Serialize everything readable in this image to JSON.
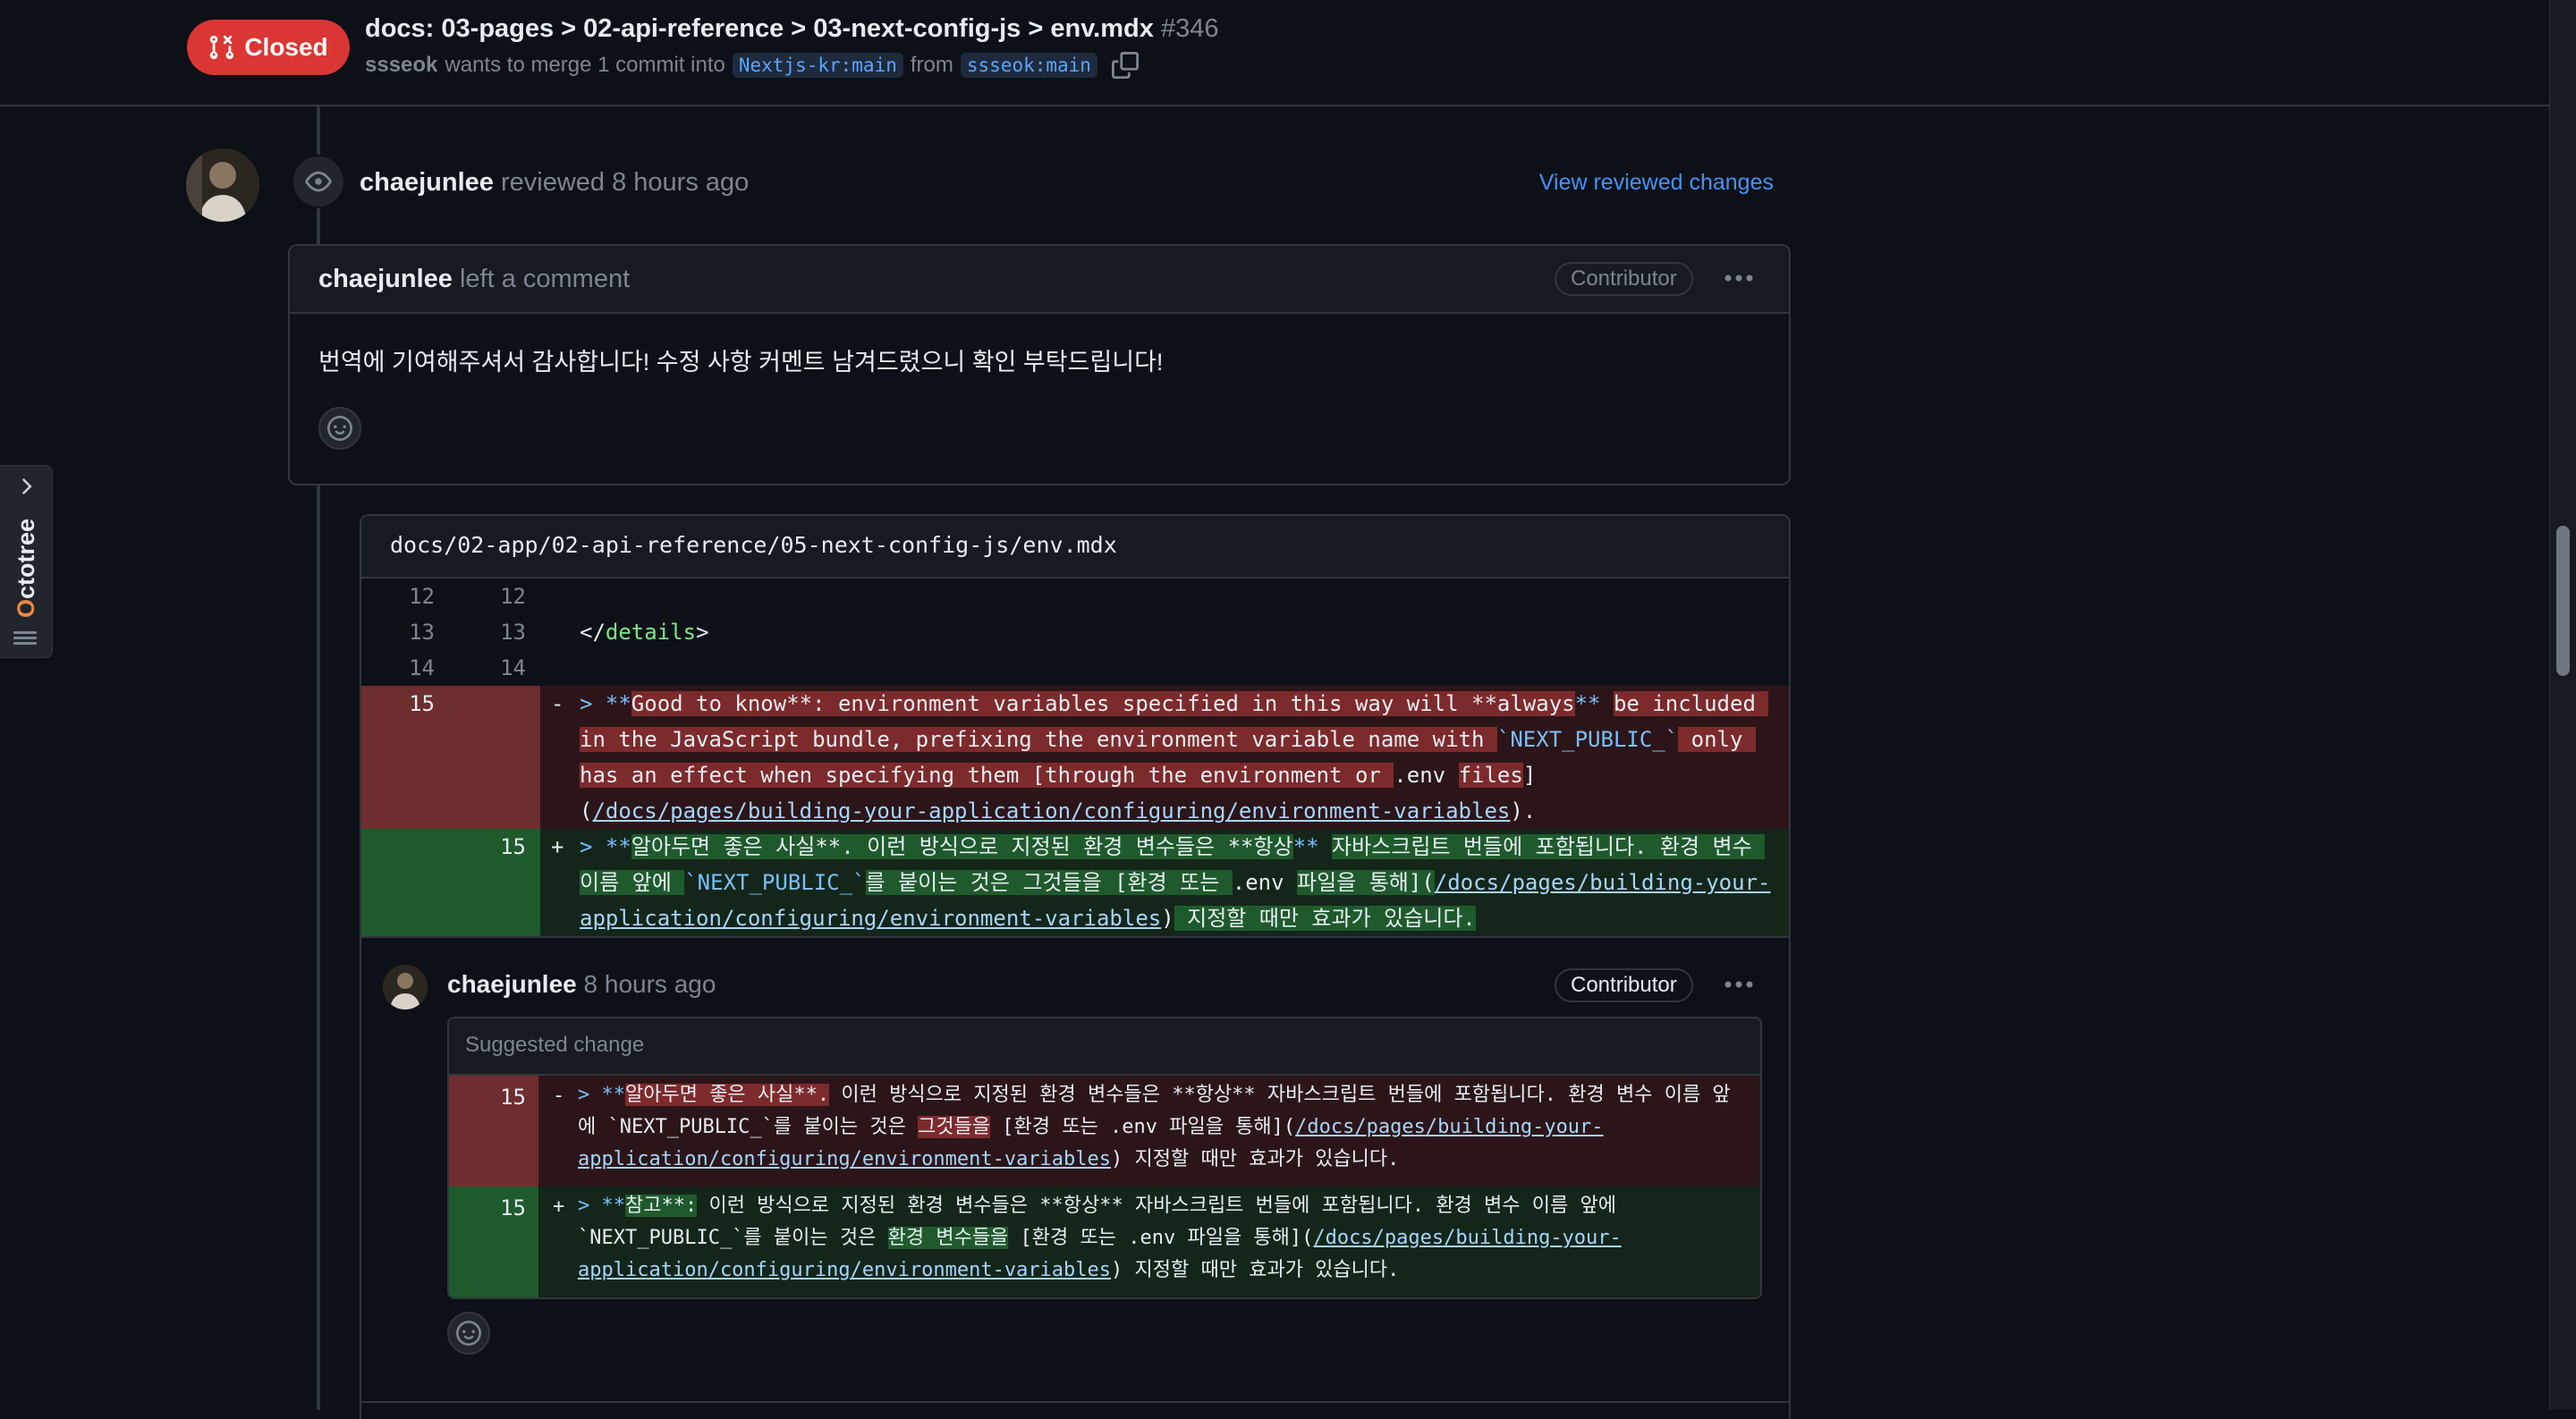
{
  "header": {
    "state": "Closed",
    "title": "docs: 03-pages > 02-api-reference > 03-next-config-js > env.mdx",
    "number": "#346",
    "author": "ssseok",
    "merge_text": "wants to merge 1 commit into",
    "base_branch": "Nextjs-kr:main",
    "from_text": "from",
    "head_branch": "ssseok:main"
  },
  "octotree": {
    "label_first": "O",
    "label_rest": "ctotree"
  },
  "review": {
    "reviewer": "chaejunlee",
    "action": "reviewed",
    "time": "8 hours ago",
    "view_changes": "View reviewed changes"
  },
  "comment": {
    "author": "chaejunlee",
    "action": "left a comment",
    "badge": "Contributor",
    "body": "번역에 기여해주셔서 감사합니다! 수정 사항 커멘트 남겨드렸으니 확인 부탁드립니다!"
  },
  "thread": {
    "file_path": "docs/02-app/02-api-reference/05-next-config-js/env.mdx",
    "context_lines": [
      {
        "old": "12",
        "new": "12",
        "text": ""
      },
      {
        "old": "13",
        "new": "13",
        "text_pre": "</",
        "text_tag": "details",
        "text_post": ">"
      },
      {
        "old": "14",
        "new": "14",
        "text": ""
      }
    ],
    "del_line": {
      "old": "15",
      "sign": "-",
      "p1": "> **",
      "p2": "Good to know**: environment variables specified in this way will **always",
      "p3": "** ",
      "p4": "be included in the JavaScript bundle, prefixing the environment variable name with ",
      "p5": "`NEXT_PUBLIC_`",
      "p6": " only has an effect when specifying them [through the environment or ",
      "p7": ".env ",
      "p8": "files",
      "p9": "](",
      "p10": "/docs/pages/building-your-application/configuring/environment-variables",
      "p11": ")."
    },
    "add_line": {
      "new": "15",
      "sign": "+",
      "p1": "> **",
      "p2": "알아두면 좋은 사실**. 이런 방식으로 지정된 환경 변수들은 **항상",
      "p3": "** ",
      "p4": "자바스크립트 번들에 포함됩니다. 환경 변수 이름 앞에 ",
      "p5": "`NEXT_PUBLIC_`",
      "p6": "를 붙이는 것은 그것들을 [환경 또는 ",
      "p7": ".env ",
      "p8": "파일을 통해](",
      "p9": "/docs/pages/building-your-application/configuring/environment-variables",
      "p10": ")",
      "p11": " 지정할 때만 효과가 있습니다."
    },
    "reply": {
      "author": "chaejunlee",
      "time": "8 hours ago",
      "badge": "Contributor",
      "suggestion_title": "Suggested change",
      "del": {
        "num": "15",
        "sign": "-",
        "a": "> **",
        "b": "알아두면 좋은 사실**.",
        "c": " 이런 방식으로 지정된 환경 변수들은 **항상** 자바스크립트 번들에 포함됩니다. 환경 변수 이름 앞에 `NEXT_PUBLIC_`를 붙이는 것은 ",
        "d": "그것들을",
        "e": " [환경 또는 .env 파일을 통해](",
        "f": "/docs/pages/building-your-application/configuring/environment-variables",
        "g": ") 지정할 때만 효과가 있습니다."
      },
      "add": {
        "num": "15",
        "sign": "+",
        "a": "> **",
        "b": "참고**:",
        "c": " 이런 방식으로 지정된 환경 변수들은 **항상** 자바스크립트 번들에 포함됩니다. 환경 변수 이름 앞에 `NEXT_PUBLIC_`를 붙이는 것은 ",
        "d": "환경 변수들을",
        "e": " [환경 또는 .env 파일을 통해](",
        "f": "/docs/pages/building-your-application/configuring/environment-variables",
        "g": ") 지정할 때만 효과가 있습니다."
      }
    }
  },
  "colors": {
    "background": "#0d1117",
    "closed_red": "#da3633",
    "link_blue": "#4493f8",
    "del_bg": "#2c1518",
    "add_bg": "#14261a"
  }
}
